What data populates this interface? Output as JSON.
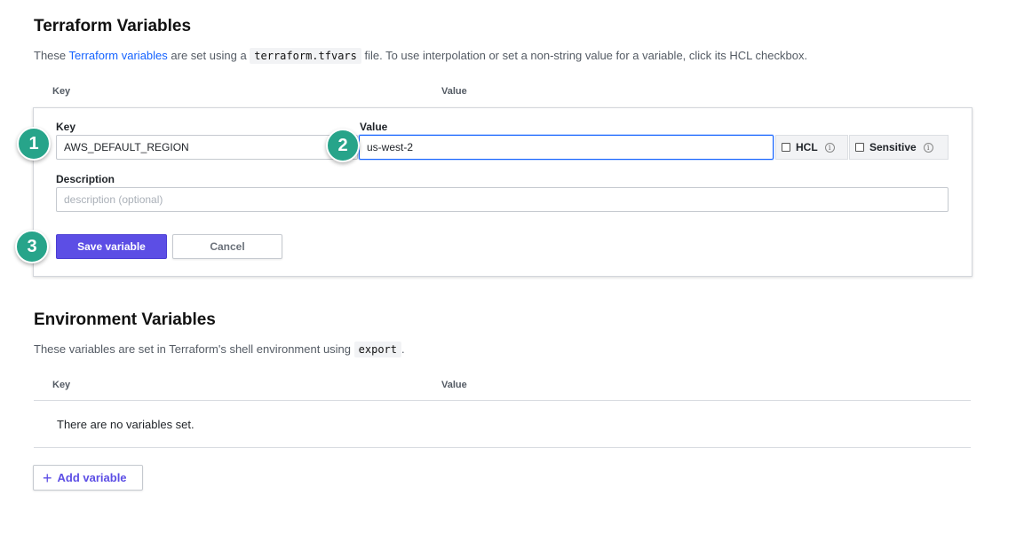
{
  "terraform_section": {
    "title": "Terraform Variables",
    "desc_prefix": "These ",
    "desc_link": "Terraform variables",
    "desc_middle": " are set using a ",
    "desc_code": "terraform.tfvars",
    "desc_suffix": " file. To use interpolation or set a non-string value for a variable, click its HCL checkbox.",
    "col_key": "Key",
    "col_value": "Value"
  },
  "form": {
    "key_label": "Key",
    "key_value": "AWS_DEFAULT_REGION",
    "value_label": "Value",
    "value_value": "us-west-2",
    "hcl_label": "HCL",
    "sensitive_label": "Sensitive",
    "description_label": "Description",
    "description_placeholder": "description (optional)",
    "save_label": "Save variable",
    "cancel_label": "Cancel"
  },
  "badges": [
    "1",
    "2",
    "3"
  ],
  "env_section": {
    "title": "Environment Variables",
    "desc_prefix": "These variables are set in Terraform's shell environment using ",
    "desc_code": "export",
    "desc_suffix": ".",
    "col_key": "Key",
    "col_value": "Value",
    "empty_text": "There are no variables set.",
    "add_label": "Add variable"
  },
  "colors": {
    "accent": "#5c4ee5",
    "link": "#1563ff",
    "badge": "#27a48a"
  },
  "icons": {
    "info": "info-circle-icon",
    "plus": "plus-icon"
  }
}
